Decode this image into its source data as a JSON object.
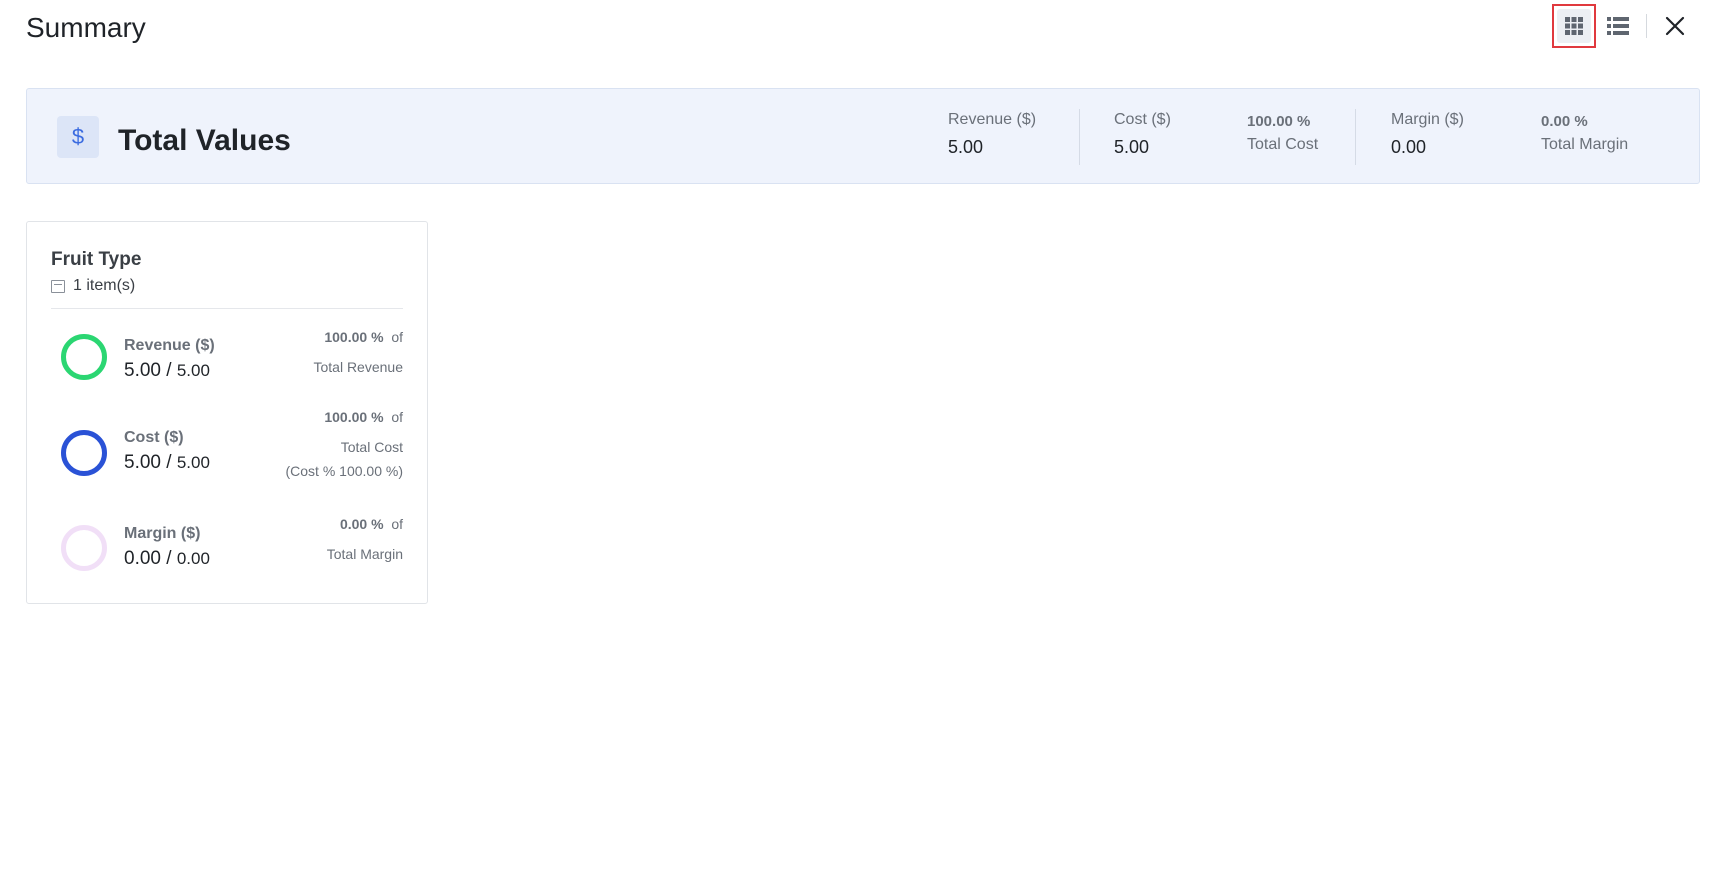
{
  "page": {
    "title": "Summary"
  },
  "toolbar": {
    "grid_view_icon": "grid-icon",
    "list_view_icon": "list-icon",
    "close_icon": "close-icon"
  },
  "totals": {
    "icon": "$",
    "title": "Total Values",
    "revenue": {
      "label": "Revenue ($)",
      "value": "5.00"
    },
    "cost": {
      "label": "Cost ($)",
      "value": "5.00",
      "pct": "100.00 %",
      "pct_label": "Total Cost"
    },
    "margin": {
      "label": "Margin ($)",
      "value": "0.00",
      "pct": "0.00 %",
      "pct_label": "Total Margin"
    }
  },
  "card": {
    "title": "Fruit Type",
    "count": "1 item(s)",
    "rows": [
      {
        "label": "Revenue ($)",
        "value": "5.00 /",
        "total": "5.00",
        "pct": "100.00 %",
        "of": "of",
        "pct_label": "Total Revenue",
        "extra": "",
        "color": "#2bd672"
      },
      {
        "label": "Cost ($)",
        "value": "5.00 /",
        "total": "5.00",
        "pct": "100.00 %",
        "of": "of",
        "pct_label": "Total Cost",
        "extra": "(Cost % 100.00 %)",
        "color": "#2a52d6"
      },
      {
        "label": "Margin ($)",
        "value": "0.00 /",
        "total": "0.00",
        "pct": "0.00 %",
        "of": "of",
        "pct_label": "Total Margin",
        "extra": "",
        "color": "#f1dff7"
      }
    ]
  }
}
